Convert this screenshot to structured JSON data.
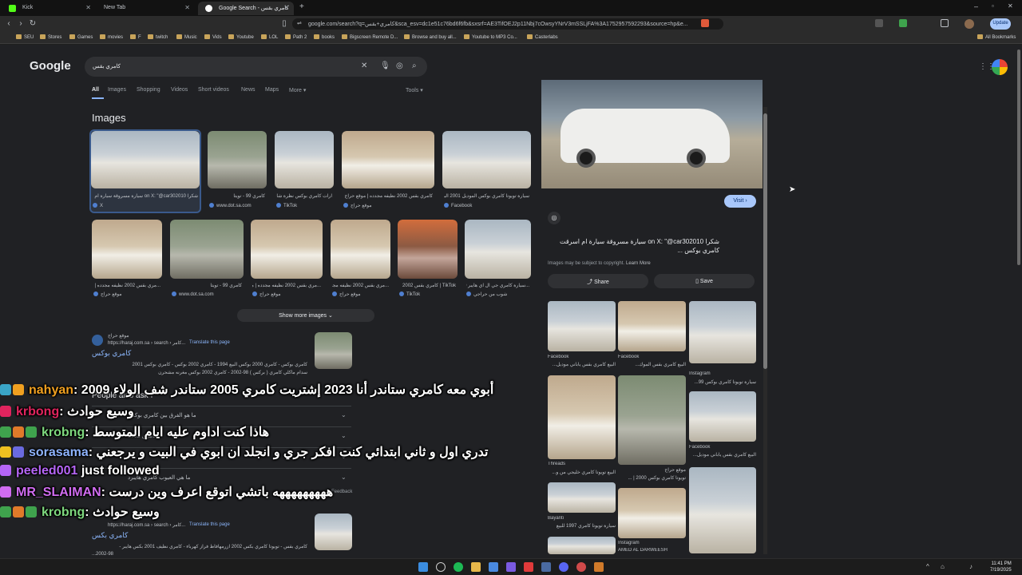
{
  "tabs": [
    {
      "title": "Kick"
    },
    {
      "title": "New Tab"
    },
    {
      "title": "Google Search - كامري بقس"
    }
  ],
  "address": {
    "url": "google.com/search?q=كامري+بقس&sca_esv=dc1e51c76bd6f6fb&sxsrf=AE3TifOEJ2p11Nbj7cOwsyYNrV3mSSLjFA%3A1752957592293&source=hp&e..."
  },
  "browser": {
    "update_label": "Update",
    "all_bookmarks": "All Bookmarks"
  },
  "bookmarks": [
    "SEU",
    "Stores",
    "Games",
    "movies",
    "F",
    "twitch",
    "Music",
    "Vids",
    "Youtube",
    "LOL",
    "Path 2",
    "books",
    "Bigscreen Remote D...",
    "Browse and buy all...",
    "Youtube to MP3 Co...",
    "Casterlabs"
  ],
  "google": {
    "logo": "Google",
    "query": "كامري بقس",
    "filters": [
      "All",
      "Images",
      "Shopping",
      "Videos",
      "Short videos",
      "News",
      "Maps",
      "More ▾"
    ],
    "tools": "Tools ▾",
    "images_heading": "Images",
    "show_more": "Show more images  ⌄"
  },
  "thumbs_row1": [
    {
      "cap": "شكرا on X: \"@car302010 سيارة مسروقة سيارة ام",
      "src": "X"
    },
    {
      "cap": "كامري 99 - تويتا",
      "src": "www.dot.sa.com"
    },
    {
      "cap": "ارات كامري بوكس نظرة شا",
      "src": "TikTok"
    },
    {
      "cap": "كامري بقس 2002 نظيفه مجدده | موقع حراج",
      "src": "موقع حراج"
    },
    {
      "cap": "سيارة تويوتا كامري بوكس الموديل 2001 البيع",
      "src": "Facebook"
    }
  ],
  "thumbs_row2": [
    {
      "cap": "...مري بقس 2002 نظيفه مجدده |",
      "src": "موقع حراج"
    },
    {
      "cap": "كامري 99 - تويتا",
      "src": "www.dot.sa.com"
    },
    {
      "cap": "...مري بقس 2002 نظيفه مجدده | مو",
      "src": "موقع حراج"
    },
    {
      "cap": "...مري بقس 2002 نظيفه مجدد",
      "src": "موقع حراج"
    },
    {
      "cap": "TikTok | كامري بقس 2002",
      "src": "TikTok"
    },
    {
      "cap": "...سيارة كامري جي ال اي هايبر 20",
      "src": "شوب من حراجي"
    }
  ],
  "result1": {
    "site": "موقع حراج",
    "path": "https://haraj.com.sa › search › كامر...",
    "translate": "Translate this page",
    "title": "كامري بوكس",
    "snippet1": "كامري بوكس - كامري 2000 بوكس البيع 1994 - كامري 2002 بوكس - كامري بوكس 2001",
    "snippet2": "سدام ماكلي كامري ( بركس ) 98-2002 - كامري 2002 بوكس مغرنه مشحرن"
  },
  "people_also_ask": "People also ask ⁝",
  "paa_questions": [
    "ما هو الفرق بين كامري بوكس",
    "كامري 2002",
    "...",
    "ما هي العيوب كامري هايبرد"
  ],
  "feedback": "Feedback",
  "result2": {
    "path": "https://haraj.com.sa › search › كامر...",
    "translate": "Translate this page",
    "title": "كامري بكس",
    "snippet1": "كامري بقس - تويوتا كامري بكس 2002 ازرمهافاظ فراز كهرباء - كامري نظيف 2001 بكس هايبر -",
    "snippet2": "...2002-98"
  },
  "panel": {
    "source": "X",
    "title": "شكرا on X: \"@car302010 سيارة مسروقة سيارة ام اسرقت كامري بوكس ...",
    "copyright": "Images may be subject to copyright.",
    "learn_more": "Learn More",
    "visit": "Visit ›",
    "share": "Share",
    "save": "Save",
    "related": [
      {
        "src": "Facebook",
        "cap": "البيع كامري بقس ياباني موديل..."
      },
      {
        "src": "Facebook",
        "cap": "البيع كامري بقس الموك..."
      },
      {
        "src": "Instagram",
        "cap": "سيارة تويوتا كامري بوكس 99..."
      },
      {
        "src": "Threads",
        "cap": "البيع تويوتا كامري خليجي من و..."
      },
      {
        "src": "موقع حراج",
        "cap": "تويوتا كامري بوكس 2000 | ..."
      },
      {
        "src": "Facebook",
        "cap": "البيع كامري بقس ياباني موديل..."
      },
      {
        "src": "Bayanti",
        "cap": "سيارة تويوتا كامري 1997 للبيع"
      },
      {
        "src": "Instagram",
        "cap": "AMED AL DARWEESH"
      }
    ]
  },
  "chat": [
    {
      "user": "nahyan",
      "color": "#f0a020",
      "msg": "أبوي معه كامري ستاندر أنا 2023 إشتريت كامري 2005 ستاندر شف الولاء 2009"
    },
    {
      "user": "krbong",
      "color": "#e0245e",
      "msg": "وسيع حوادث"
    },
    {
      "user": "krobng",
      "color": "#7ed87e",
      "msg": "هاذا كنت اداوم عليه ايام المتوسط"
    },
    {
      "user": "sorasama",
      "color": "#8fb4ff",
      "msg": "تدري اول و ثاني ابتدائي كنت افكر جري و انجلد ان ابوي في البيت و يرجعني"
    },
    {
      "user": "peeled001",
      "color": "#b565f5",
      "msg": "just followed"
    },
    {
      "user": "MR_SLAIMAN",
      "color": "#d06cf0",
      "msg": "هههههههههه باتشي اتوقع اعرف وين درست"
    },
    {
      "user": "krobng",
      "color": "#7ed87e",
      "msg": "وسيع حوادث"
    }
  ],
  "clock": {
    "time": "11:41 PM",
    "date": "7/19/2025"
  }
}
